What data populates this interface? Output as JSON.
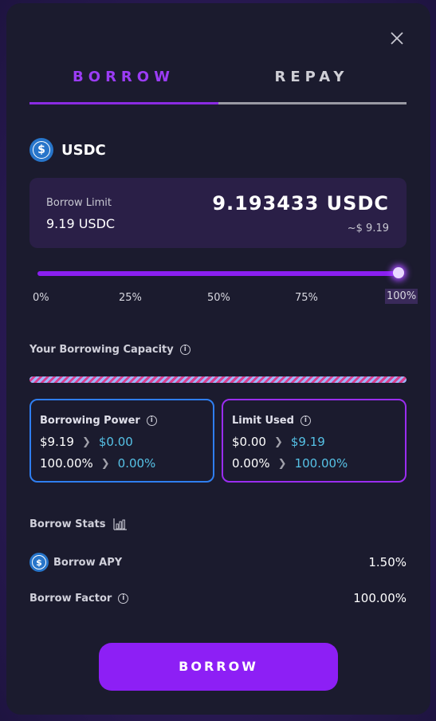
{
  "tabs": {
    "borrow": "BORROW",
    "repay": "REPAY"
  },
  "token": {
    "symbol": "USDC",
    "icon": "usdc-icon"
  },
  "limit": {
    "label": "Borrow Limit",
    "value": "9.19 USDC",
    "amount": "9.193433 USDC",
    "usd": "~$ 9.19"
  },
  "slider": {
    "value_percent": 100,
    "ticks": [
      "0%",
      "25%",
      "50%",
      "75%",
      "100%"
    ]
  },
  "capacity": {
    "title": "Your Borrowing Capacity"
  },
  "power": {
    "title": "Borrowing Power",
    "from_amount": "$9.19",
    "to_amount": "$0.00",
    "from_pct": "100.00%",
    "to_pct": "0.00%"
  },
  "limit_used": {
    "title": "Limit Used",
    "from_amount": "$0.00",
    "to_amount": "$9.19",
    "from_pct": "0.00%",
    "to_pct": "100.00%"
  },
  "stats": {
    "title": "Borrow Stats",
    "apy_label": "Borrow APY",
    "apy_value": "1.50%",
    "factor_label": "Borrow Factor",
    "factor_value": "100.00%"
  },
  "button": {
    "label": "BORROW"
  },
  "colors": {
    "accent": "#8d1ff5",
    "power_border": "#2f7ef0",
    "limit_border": "#9a2df0",
    "new_value": "#56c2e6",
    "usdc_blue": "#2775ca"
  }
}
